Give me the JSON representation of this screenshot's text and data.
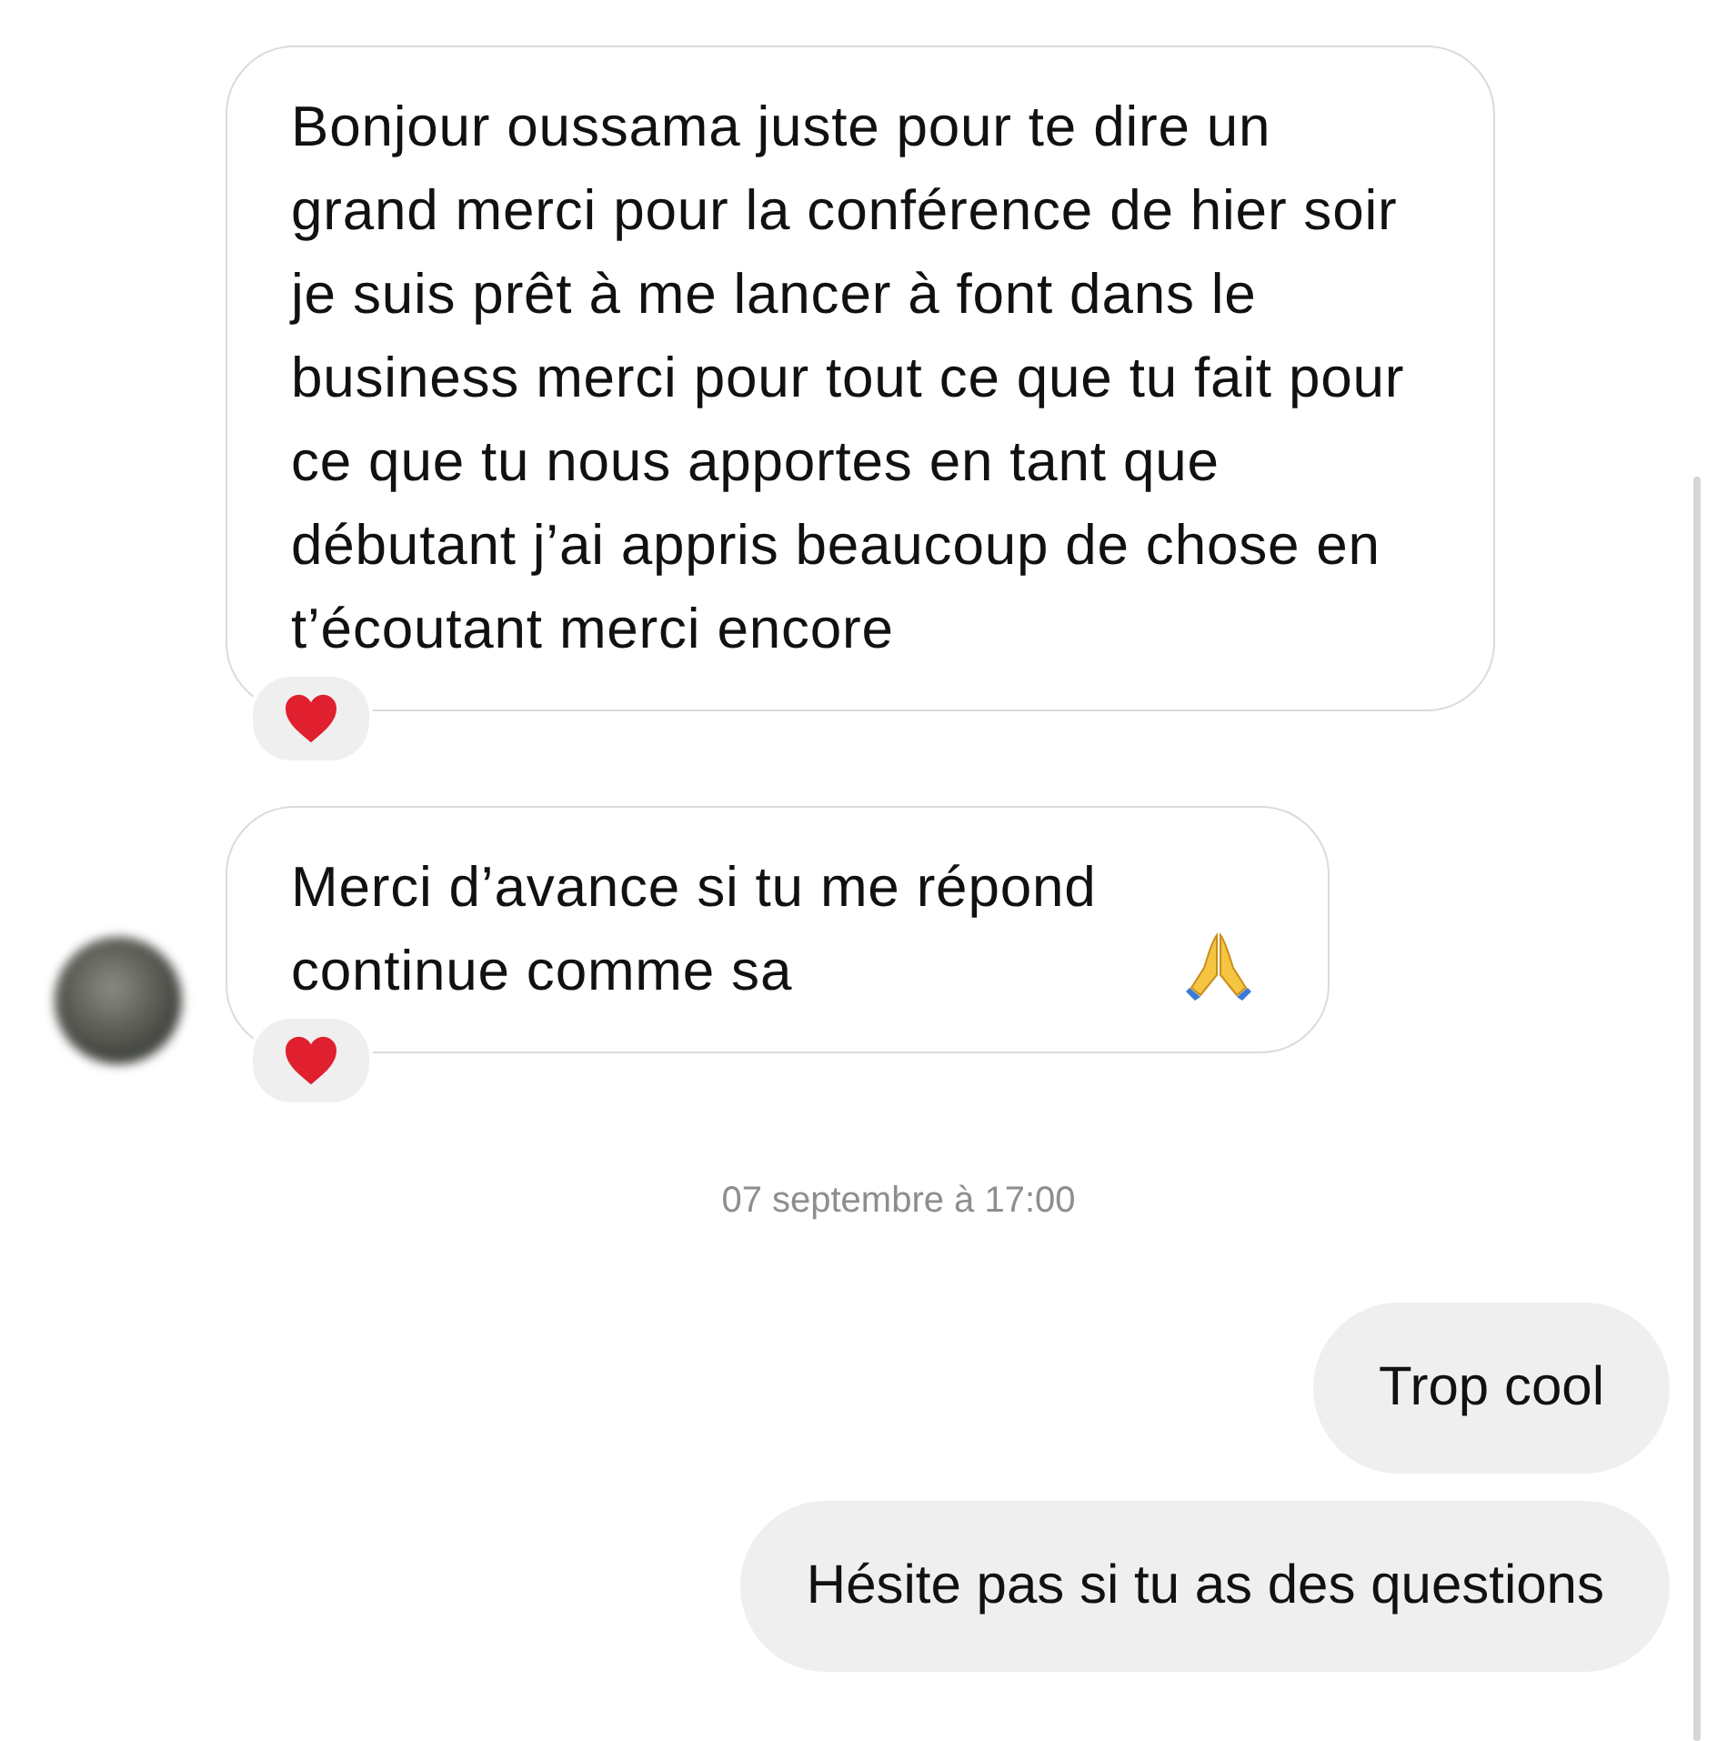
{
  "messages": [
    {
      "kind": "incoming",
      "text": "Bonjour oussama juste pour te dire un grand merci pour la conférence de hier soir je suis prêt à me lancer à font dans le business merci pour tout ce que tu fait pour ce que tu nous apportes en tant que débutant j’ai appris beaucoup de chose en t’écoutant merci encore",
      "reacted": true,
      "avatar": false,
      "emoji": false
    },
    {
      "kind": "incoming",
      "text": "Merci d’avance si tu me répond continue comme sa",
      "reacted": true,
      "avatar": true,
      "emoji": true
    },
    {
      "kind": "timestamp",
      "text": "07 septembre à 17:00"
    },
    {
      "kind": "outgoing",
      "text": "Trop cool"
    },
    {
      "kind": "outgoing",
      "text": "Hésite pas si tu as des questions"
    }
  ]
}
